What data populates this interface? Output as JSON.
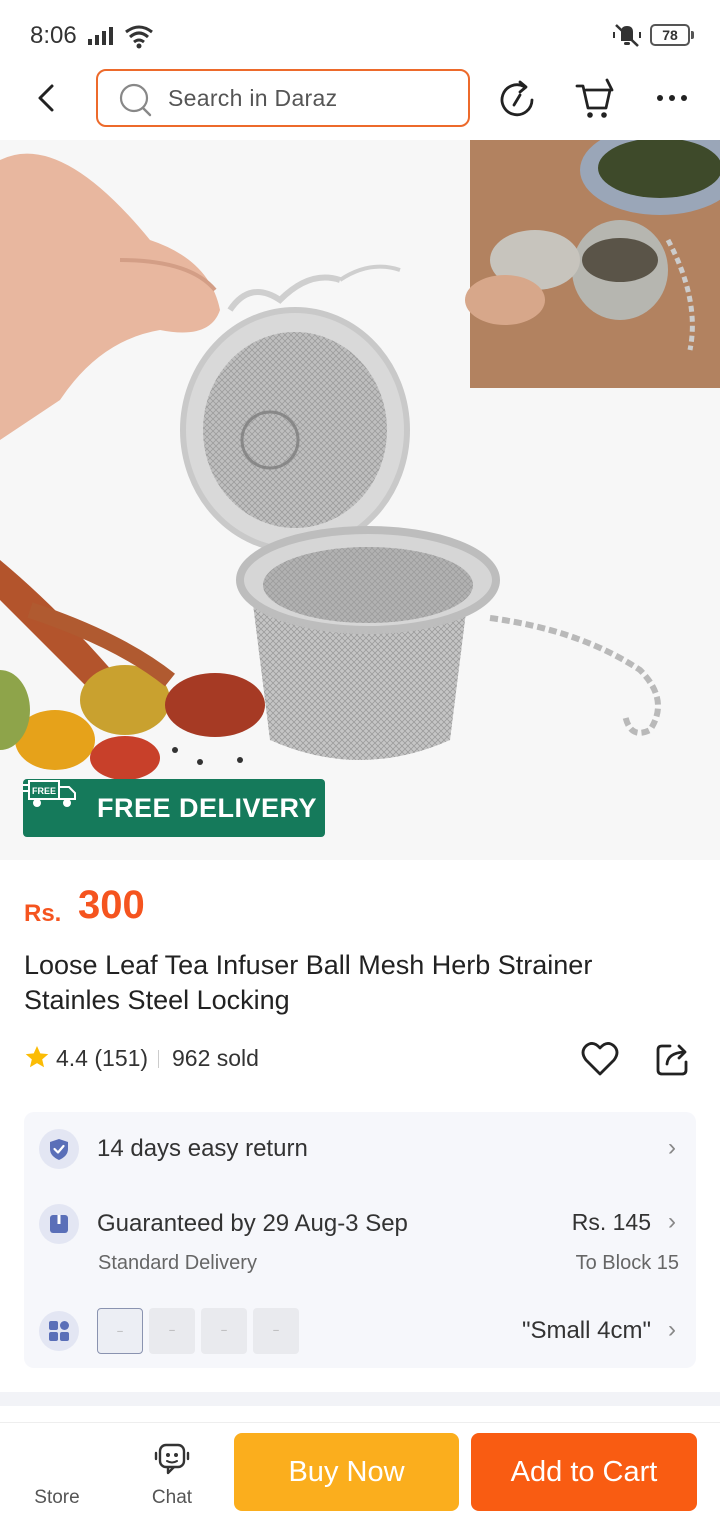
{
  "status_bar": {
    "time": "8:06",
    "battery": "78"
  },
  "header": {
    "search_placeholder": "Search in Daraz"
  },
  "hero": {
    "badge": {
      "icon_text": "FREE",
      "text": "FREE DELIVERY"
    }
  },
  "product": {
    "currency": "Rs.",
    "price": "300",
    "title": "Loose Leaf Tea Infuser Ball Mesh Herb Strainer Stainles Steel Locking",
    "rating": "4.4 (151)",
    "sold": "962 sold"
  },
  "info": {
    "return": "14 days easy return",
    "delivery": {
      "title": "Guaranteed by 29 Aug-3 Sep",
      "subtitle": "Standard Delivery",
      "price": "Rs. 145",
      "location": "To Block 15"
    },
    "variant": {
      "selected": "\"Small 4cm\""
    }
  },
  "bottom_bar": {
    "store_label": "Store",
    "chat_label": "Chat",
    "buy_now": "Buy Now",
    "add_to_cart": "Add to Cart"
  },
  "colors": {
    "accent": "#f95c12",
    "buy_now": "#fbae1d",
    "badge": "#157a5b",
    "price": "#f5541f"
  }
}
